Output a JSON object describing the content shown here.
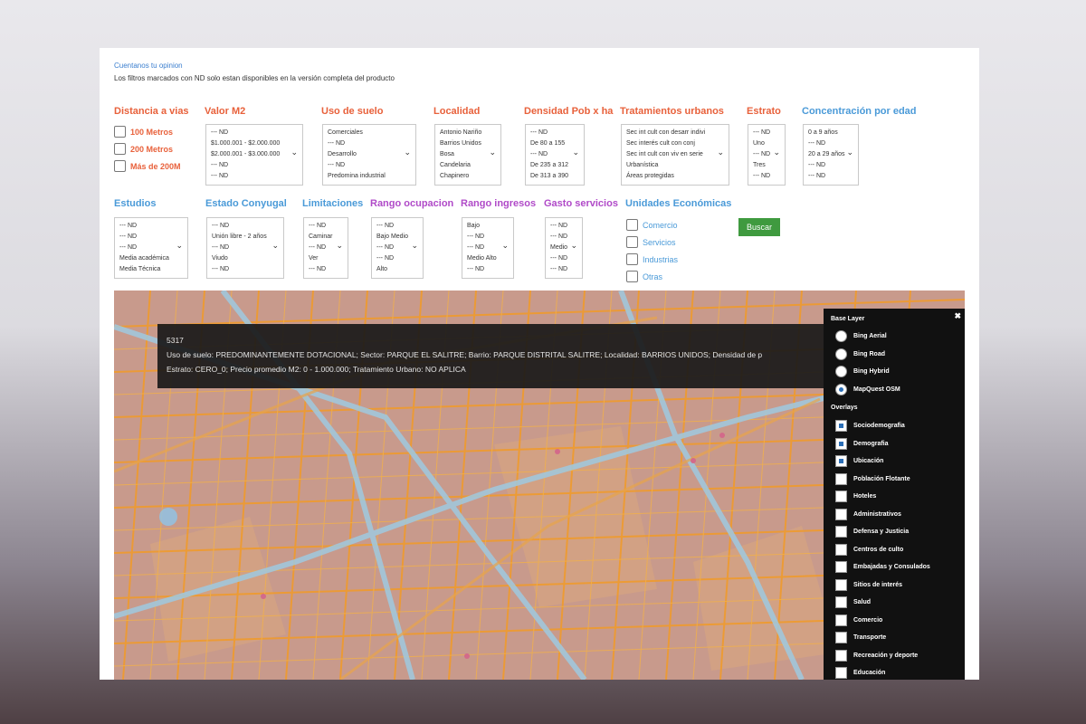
{
  "header": {
    "feedback_link": "Cuentanos tu opinion",
    "notice": "Los filtros marcados con ND solo estan disponibles en la versión completa del producto"
  },
  "filters_row1": {
    "distancia": {
      "label": "Distancia a vias",
      "options": [
        "100 Metros",
        "200 Metros",
        "Más de 200M"
      ]
    },
    "valor_m2": {
      "label": "Valor M2",
      "items": [
        "--- ND",
        "$1.000.001 - $2.000.000",
        "$2.000.001 - $3.000.000",
        "--- ND",
        "--- ND"
      ]
    },
    "uso_suelo": {
      "label": "Uso de suelo",
      "items": [
        "Comerciales",
        "--- ND",
        "Desarrollo",
        "--- ND",
        "Predomina industrial"
      ]
    },
    "localidad": {
      "label": "Localidad",
      "items": [
        "Antonio Nariño",
        "Barrios Unidos",
        "Bosa",
        "Candelaria",
        "Chapinero"
      ]
    },
    "densidad": {
      "label": "Densidad Pob x ha",
      "items": [
        "--- ND",
        "De 80 a 155",
        "--- ND",
        "De 235 a 312",
        "De 313 a 390"
      ]
    },
    "tratamientos": {
      "label": "Tratamientos urbanos",
      "items": [
        "Sec int cult con desarr indivi",
        "Sec interés cult con conj",
        "Sec int cult con viv en serie",
        "Urbanística",
        "Áreas protegidas"
      ]
    },
    "estrato": {
      "label": "Estrato",
      "items": [
        "--- ND",
        "Uno",
        "--- ND",
        "Tres",
        "--- ND"
      ]
    },
    "edad": {
      "label": "Concentración por edad",
      "items": [
        "0 a 9 años",
        "--- ND",
        "20 a 29 años",
        "--- ND",
        "--- ND"
      ]
    }
  },
  "filters_row2": {
    "estudios": {
      "label": "Estudios",
      "items": [
        "--- ND",
        "--- ND",
        "--- ND",
        "Media académica",
        "Media Técnica"
      ]
    },
    "conyugal": {
      "label": "Estado Conyugal",
      "items": [
        "--- ND",
        "Unión libre - 2 años",
        "--- ND",
        "Viudo",
        "--- ND"
      ]
    },
    "limitaciones": {
      "label": "Limitaciones",
      "items": [
        "--- ND",
        "Caminar",
        "--- ND",
        "Ver",
        "--- ND"
      ]
    },
    "ocupacion": {
      "label": "Rango ocupacion",
      "items": [
        "--- ND",
        "Bajo Medio",
        "--- ND",
        "--- ND",
        "Alto"
      ]
    },
    "ingresos": {
      "label": "Rango ingresos",
      "items": [
        "Bajo",
        "--- ND",
        "--- ND",
        "Medio Alto",
        "--- ND"
      ]
    },
    "gasto": {
      "label": "Gasto servicios",
      "items": [
        "--- ND",
        "--- ND",
        "Medio",
        "--- ND",
        "--- ND"
      ]
    },
    "unidades": {
      "label": "Unidades Económicas",
      "options": [
        "Comercio",
        "Servicios",
        "Industrias",
        "Otras"
      ]
    },
    "search_button": "Buscar"
  },
  "map": {
    "tooltip": {
      "id": "5317",
      "line1": "Uso de suelo: PREDOMINANTEMENTE DOTACIONAL; Sector: PARQUE EL SALITRE; Barrio: PARQUE DISTRITAL SALITRE; Localidad: BARRIOS UNIDOS; Densidad de p",
      "line2": "Estrato: CERO_0; Precio promedio M2: 0 - 1.000.000; Tratamiento Urbano: NO APLICA"
    },
    "layer_switcher": {
      "close": "✖",
      "base_title": "Base Layer",
      "base_layers": [
        "Bing Aerial",
        "Bing Road",
        "Bing Hybrid",
        "MapQuest OSM"
      ],
      "base_selected": 3,
      "overlays_title": "Overlays",
      "overlays": [
        "Sociodemografia",
        "Demografia",
        "Ubicación",
        "Población Flotante",
        "Hoteles",
        "Administrativos",
        "Defensa y Justicia",
        "Centros de culto",
        "Embajadas y Consulados",
        "Sitios de interés",
        "Salud",
        "Comercio",
        "Transporte",
        "Recreación y deporte",
        "Educación"
      ],
      "overlays_checked": [
        true,
        true,
        true,
        false,
        false,
        false,
        false,
        false,
        false,
        false,
        false,
        false,
        false,
        false,
        false
      ]
    }
  },
  "colors": {
    "orange_label": "#e8613b",
    "blue_label": "#4a9ad8",
    "purple_label": "#b04ac8",
    "button": "#3f9a3f",
    "map_base": "#c8988a",
    "roads": "#f0a030",
    "water": "#8fc4e8"
  }
}
